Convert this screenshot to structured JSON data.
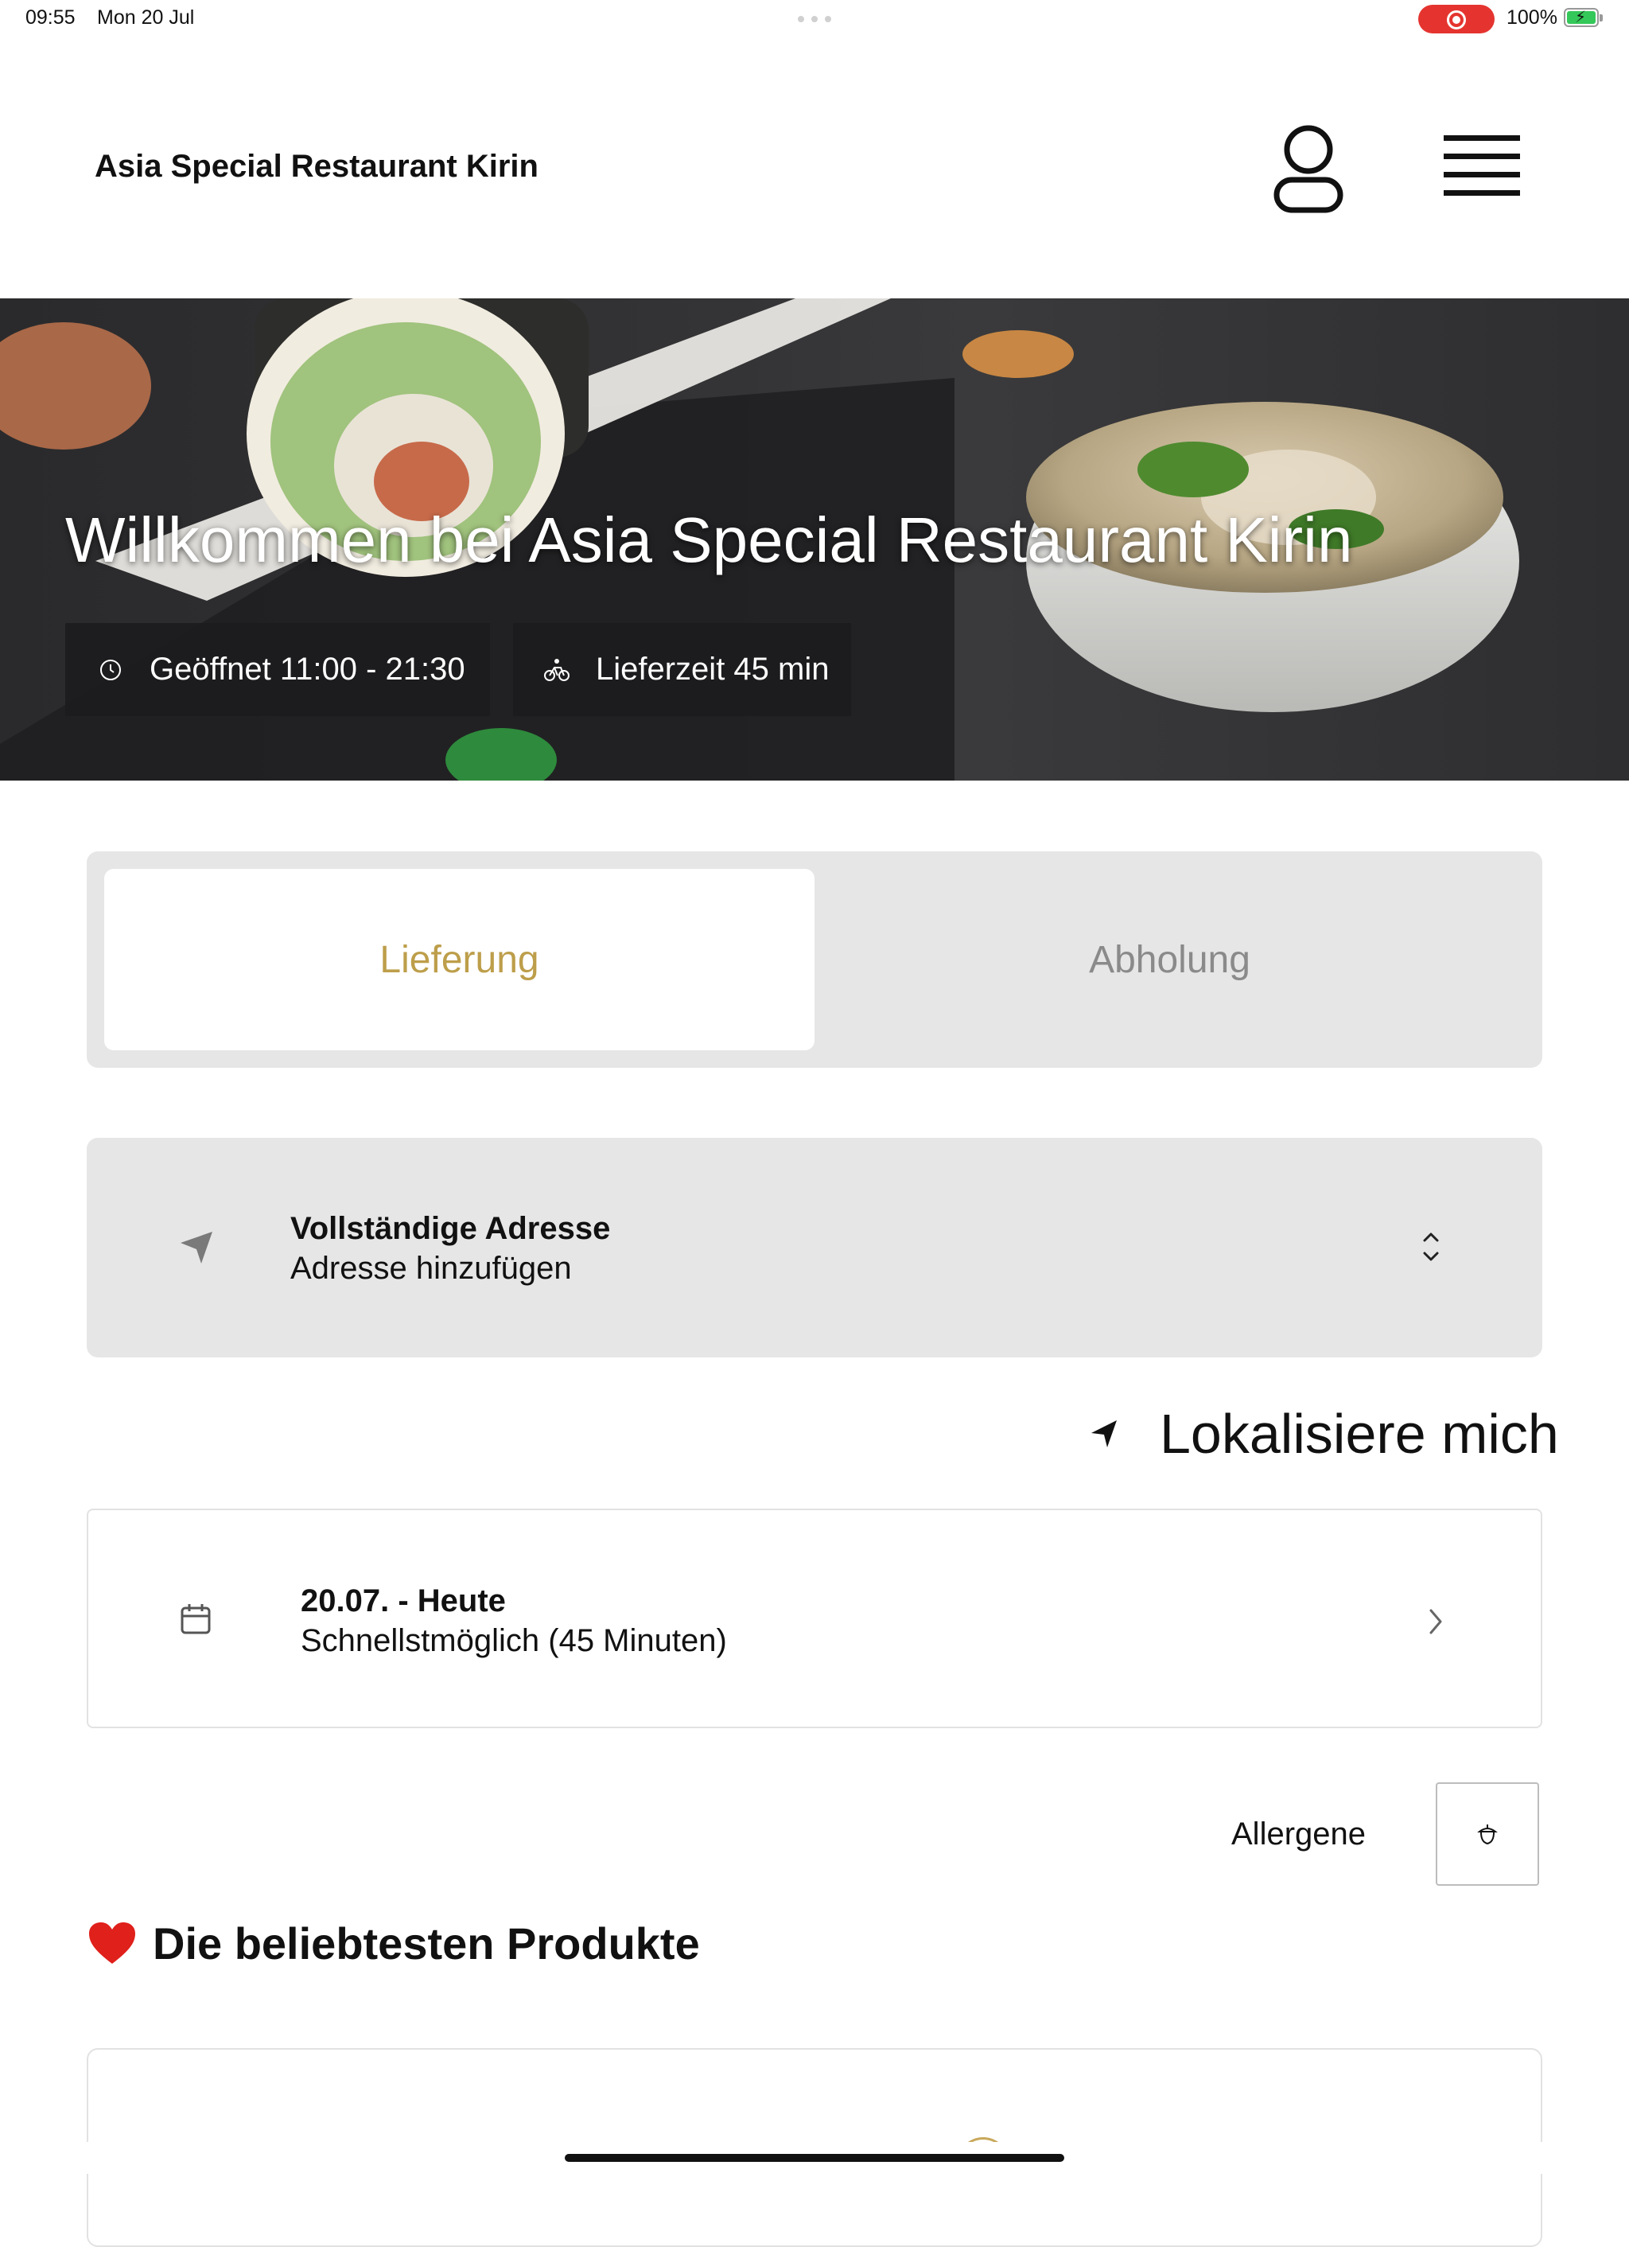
{
  "status_bar": {
    "time": "09:55",
    "date": "Mon 20 Jul",
    "battery": "100%",
    "battery_level": 1.0,
    "recording_color": "#e5342f"
  },
  "header": {
    "brand": "Asia Special Restaurant Kirin",
    "user_icon": "user-icon",
    "menu_icon": "hamburger-menu-icon"
  },
  "hero": {
    "title": "Willkommen bei Asia Special Restaurant Kirin",
    "opening_hours": "Geöffnet 11:00 - 21:30",
    "delivery_time": "Lieferzeit 45 min",
    "opening_icon": "clock-icon",
    "delivery_icon": "bicycle-icon"
  },
  "order_mode": {
    "tabs": [
      {
        "label": "Lieferung",
        "selected": true
      },
      {
        "label": "Abholung",
        "selected": false
      }
    ],
    "accent_color": "#bd9e4a"
  },
  "address": {
    "title": "Vollständige Adresse",
    "value": "Adresse hinzufügen",
    "icon": "location-arrow-icon"
  },
  "locate": {
    "label": "Lokalisiere mich",
    "icon": "location-arrow-icon"
  },
  "schedule": {
    "title": "20.07. - Heute",
    "value": "Schnellstmöglich (45 Minuten)",
    "icon": "calendar-icon"
  },
  "allergens": {
    "label": "Allergene",
    "icon": "acorn-icon"
  },
  "popular": {
    "emoji": "heart-icon",
    "title": "Die beliebtesten Produkte"
  }
}
